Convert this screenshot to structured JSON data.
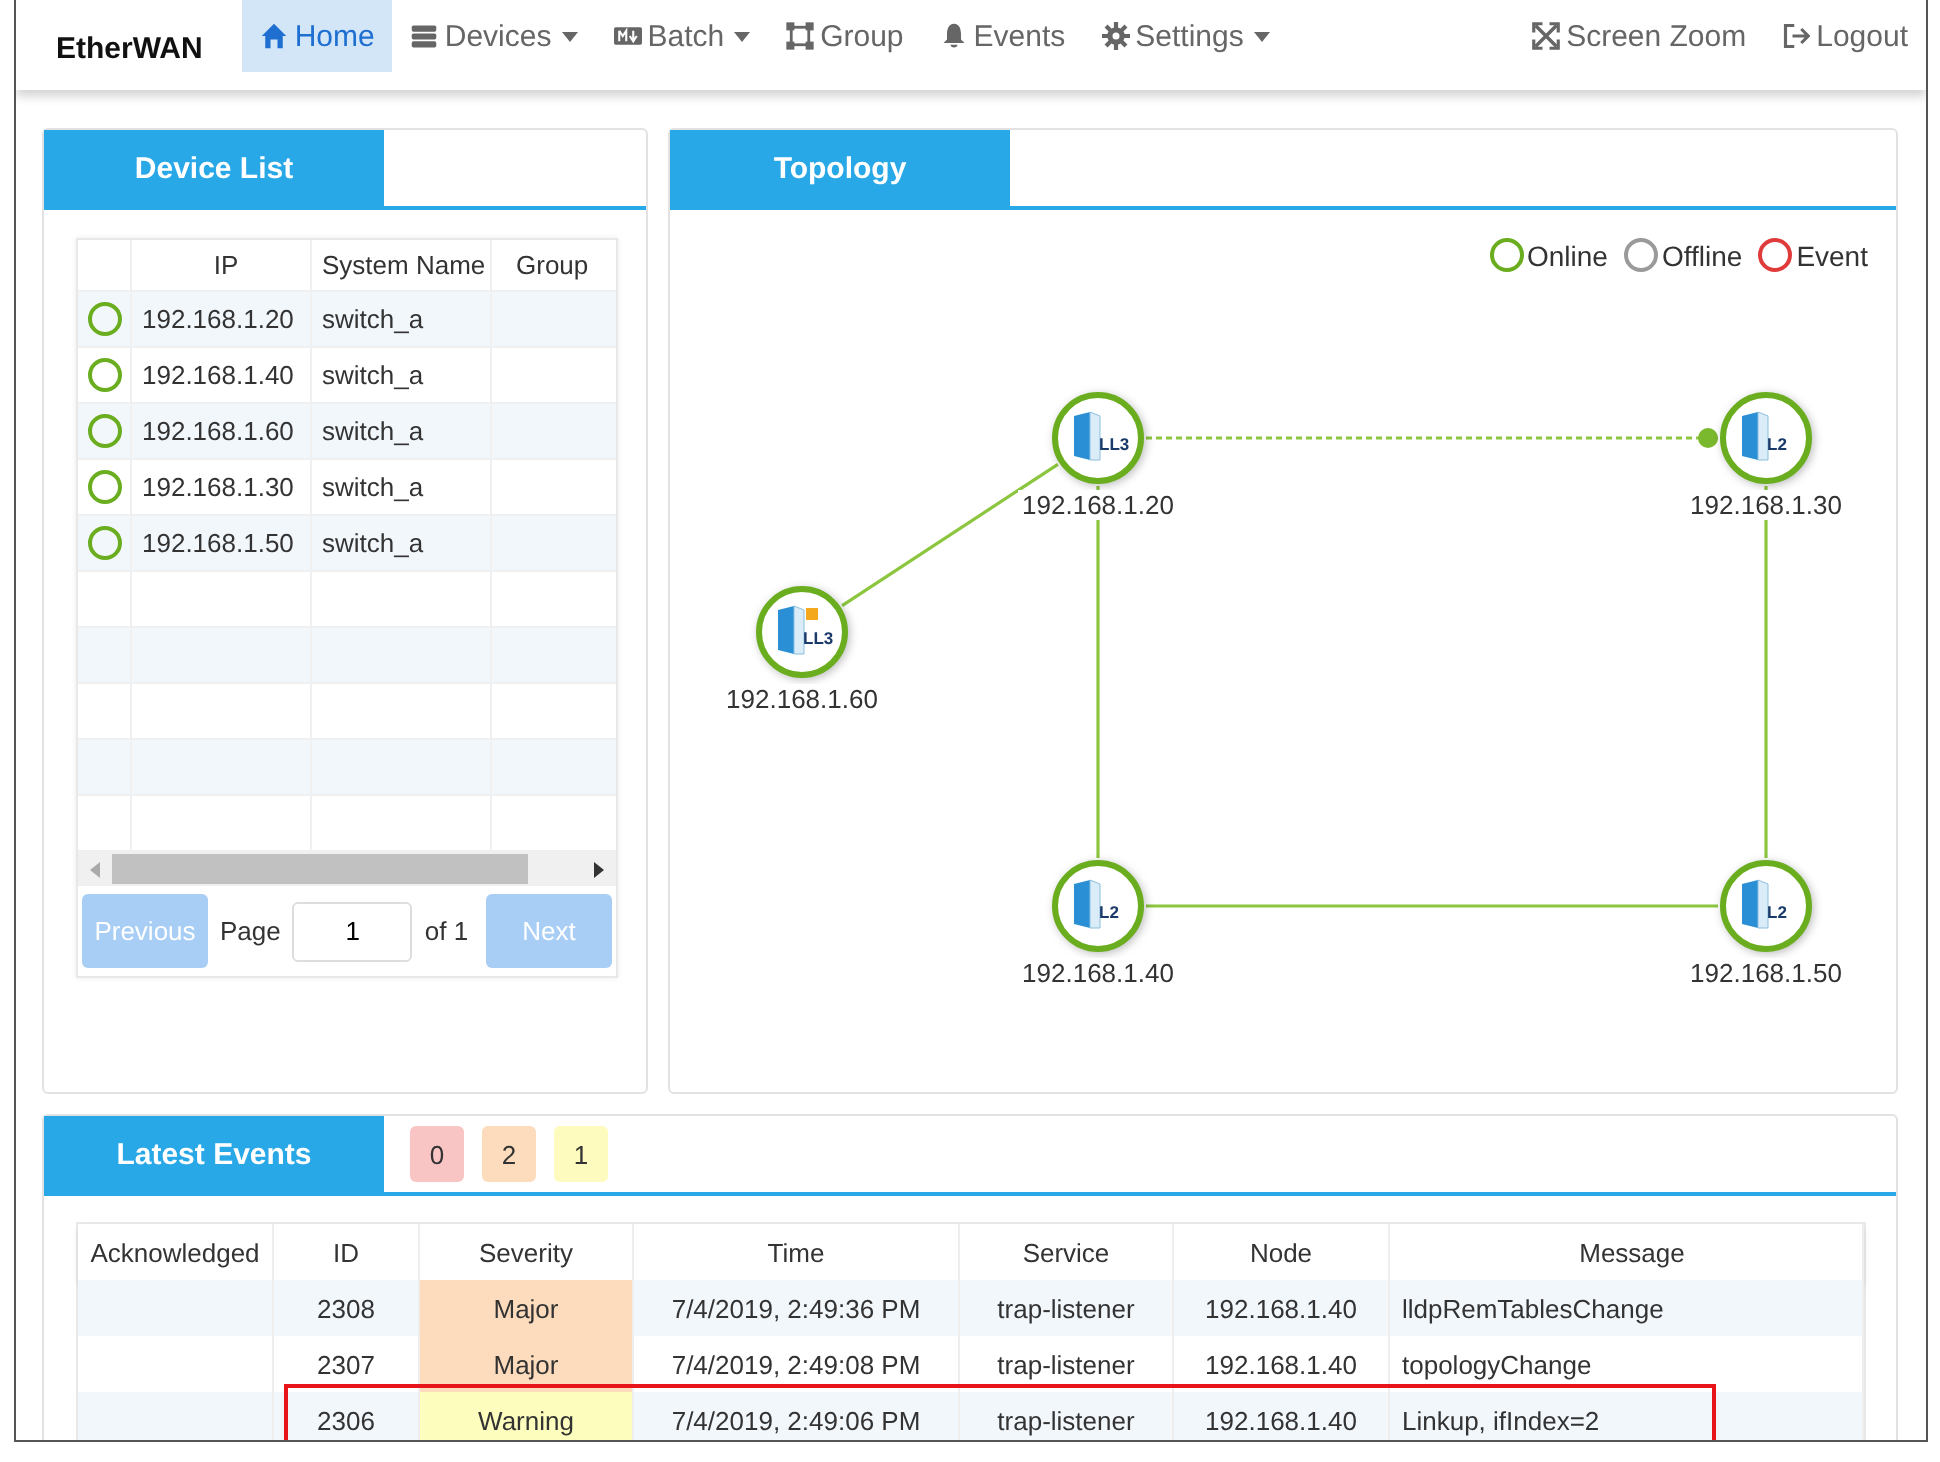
{
  "navbar": {
    "brand": "EtherWAN",
    "items": [
      {
        "label": "Home",
        "dropdown": false,
        "selected": true
      },
      {
        "label": "Devices",
        "dropdown": true,
        "selected": false
      },
      {
        "label": "Batch",
        "dropdown": true,
        "selected": false
      },
      {
        "label": "Group",
        "dropdown": false,
        "selected": false
      },
      {
        "label": "Events",
        "dropdown": false,
        "selected": false
      },
      {
        "label": "Settings",
        "dropdown": true,
        "selected": false
      }
    ],
    "right_items": [
      {
        "label": "Screen Zoom"
      },
      {
        "label": "Logout"
      }
    ]
  },
  "device_list": {
    "title": "Device List",
    "columns": [
      "IP",
      "System Name",
      "Group"
    ],
    "rows": [
      {
        "online": true,
        "ip": "192.168.1.20",
        "system_name": "switch_a"
      },
      {
        "online": true,
        "ip": "192.168.1.40",
        "system_name": "switch_a"
      },
      {
        "online": true,
        "ip": "192.168.1.60",
        "system_name": "switch_a"
      },
      {
        "online": true,
        "ip": "192.168.1.30",
        "system_name": "switch_a"
      },
      {
        "online": true,
        "ip": "192.168.1.50",
        "system_name": "switch_a"
      }
    ],
    "pagination": {
      "previous": "Previous",
      "page_label": "Page",
      "page": "1",
      "of": "of 1",
      "next": "Next"
    }
  },
  "topology": {
    "title": "Topology",
    "legend": [
      {
        "label": "Online",
        "color": "#6aad1f"
      },
      {
        "label": "Offline",
        "color": "#9a9a9a"
      },
      {
        "label": "Event",
        "color": "#e03b3b"
      }
    ],
    "nodes": [
      {
        "label": "192.168.1.20",
        "layer": "LL3",
        "online": true,
        "alert": false
      },
      {
        "label": "192.168.1.30",
        "layer": "L2",
        "online": true,
        "alert": false
      },
      {
        "label": "192.168.1.60",
        "layer": "LL3",
        "online": true,
        "alert": true
      },
      {
        "label": "192.168.1.40",
        "layer": "L2",
        "online": true,
        "alert": false
      },
      {
        "label": "192.168.1.50",
        "layer": "L2",
        "online": true,
        "alert": false
      }
    ],
    "links": [
      {
        "dashed": true
      },
      {
        "dashed": false
      },
      {
        "dashed": false
      },
      {
        "dashed": false
      },
      {
        "dashed": false
      }
    ]
  },
  "latest_events": {
    "title": "Latest Events",
    "counts": [
      {
        "value": "0",
        "color": "#f9c4c4"
      },
      {
        "value": "2",
        "color": "#fddcbd"
      },
      {
        "value": "1",
        "color": "#fdfbbd"
      }
    ],
    "columns": [
      "Acknowledged",
      "ID",
      "Severity",
      "Time",
      "Service",
      "Node",
      "Message"
    ],
    "rows": [
      {
        "id": "2308",
        "severity": "Major",
        "kind": "major",
        "time": "7/4/2019, 2:49:36 PM",
        "service": "trap-listener",
        "node": "192.168.1.40",
        "message": "lldpRemTablesChange",
        "highlighted": false
      },
      {
        "id": "2307",
        "severity": "Major",
        "kind": "major",
        "time": "7/4/2019, 2:49:08 PM",
        "service": "trap-listener",
        "node": "192.168.1.40",
        "message": "topologyChange",
        "highlighted": false
      },
      {
        "id": "2306",
        "severity": "Warning",
        "kind": "warning",
        "time": "7/4/2019, 2:49:06 PM",
        "service": "trap-listener",
        "node": "192.168.1.40",
        "message": "Linkup, ifIndex=2",
        "highlighted": true
      }
    ]
  }
}
